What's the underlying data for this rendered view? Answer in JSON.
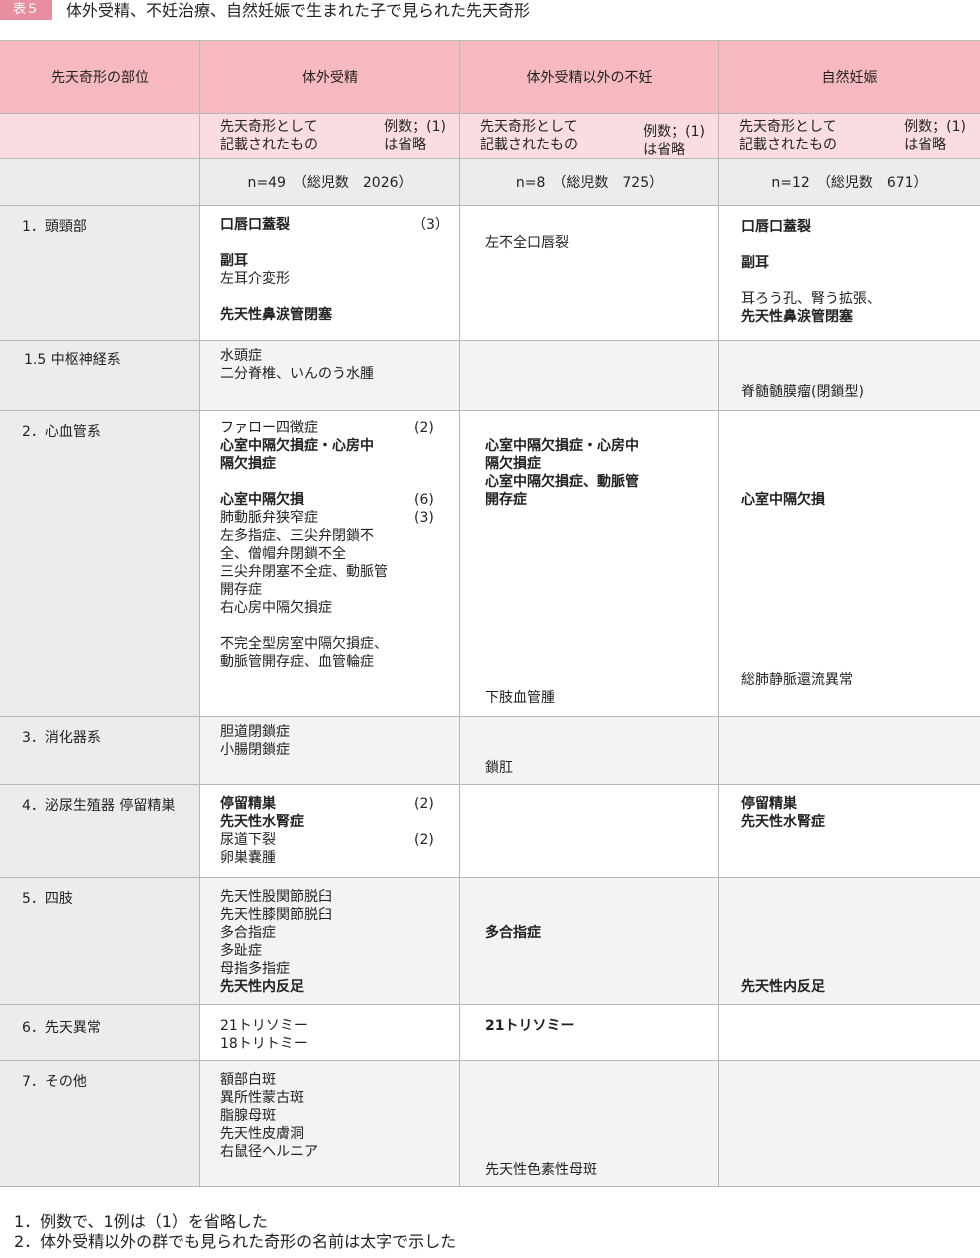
{
  "header": {
    "tag": "表５",
    "title": "体外受精、不妊治療、自然妊娠で生まれた子で見られた先天奇形"
  },
  "columns": {
    "site": "先天奇形の部位",
    "ivf": "体外受精",
    "non_ivf": "体外受精以外の不妊",
    "natural": "自然妊娠"
  },
  "subheader": {
    "left": "先天奇形として\n記載されたもの",
    "right": "例数；(1)\nは省略"
  },
  "counts": {
    "ivf": "n=49　（総児数　2026）",
    "non_ivf": "n=8　（総児数　725）",
    "natural": "n=12　（総児数　671）"
  },
  "rows": [
    {
      "category": "1．頭頸部"
    },
    {
      "category": "1.5 中枢神経系"
    },
    {
      "category": "2．心血管系"
    },
    {
      "category": "3．消化器系"
    },
    {
      "category": "4．泌尿生殖器 停留精巣"
    },
    {
      "category": "5．四肢"
    },
    {
      "category": "6．先天異常"
    },
    {
      "category": "7．その他"
    }
  ],
  "items": {
    "r1_ivf": [
      "口唇口蓋裂",
      "副耳",
      "左耳介変形",
      "先天性鼻涙管閉塞"
    ],
    "r1_ivf_count": "（3）",
    "r1_non": [
      "左不全口唇裂"
    ],
    "r1_nat": [
      "口唇口蓋裂",
      "副耳",
      "耳ろう孔、腎う拡張、",
      "先天性鼻涙管閉塞"
    ],
    "r15_ivf": [
      "水頭症",
      "二分脊椎、いんのう水腫"
    ],
    "r15_nat": [
      "脊髄髄膜瘤(閉鎖型)"
    ],
    "r2_ivf": [
      "ファロー四徴症",
      "心室中隔欠損症・心房中",
      "隔欠損症",
      "心室中隔欠損",
      "肺動脈弁狭窄症",
      "左多指症、三尖弁閉鎖不",
      "全、僧帽弁閉鎖不全",
      "三尖弁閉塞不全症、動脈管",
      "開存症",
      "右心房中隔欠損症",
      "不完全型房室中隔欠損症、",
      "動脈管開存症、血管輪症"
    ],
    "r2_ivf_counts": [
      "(2)",
      "(6)",
      "(3)"
    ],
    "r2_non": [
      "心室中隔欠損症・心房中",
      "隔欠損症",
      "心室中隔欠損症、動脈管",
      "開存症",
      "下肢血管腫"
    ],
    "r2_nat": [
      "心室中隔欠損",
      "総肺静脈還流異常"
    ],
    "r3_ivf": [
      "胆道閉鎖症",
      "小腸閉鎖症"
    ],
    "r3_non": [
      "鎖肛"
    ],
    "r4_ivf": [
      "停留精巣",
      "先天性水腎症",
      "尿道下裂",
      "卵巣嚢腫"
    ],
    "r4_ivf_counts": [
      "(2)",
      "(2)"
    ],
    "r4_nat": [
      "停留精巣",
      "先天性水腎症"
    ],
    "r5_ivf": [
      "先天性股関節脱臼",
      "先天性膝関節脱臼",
      "多合指症",
      "多趾症",
      "母指多指症",
      "先天性内反足"
    ],
    "r5_non": [
      "多合指症"
    ],
    "r5_nat": [
      "先天性内反足"
    ],
    "r6_ivf": [
      "21トリソミー",
      "18トリトミー"
    ],
    "r6_non": [
      "21トリソミー"
    ],
    "r7_ivf": [
      "額部白斑",
      "異所性蒙古斑",
      "脂腺母斑",
      "先天性皮膚洞",
      "右鼠径ヘルニア"
    ],
    "r7_non": [
      "先天性色素性母斑"
    ]
  },
  "notes": [
    "1．例数で、1例は（1）を省略した",
    "2．体外受精以外の群でも見られた奇形の名前は太字で示した"
  ]
}
